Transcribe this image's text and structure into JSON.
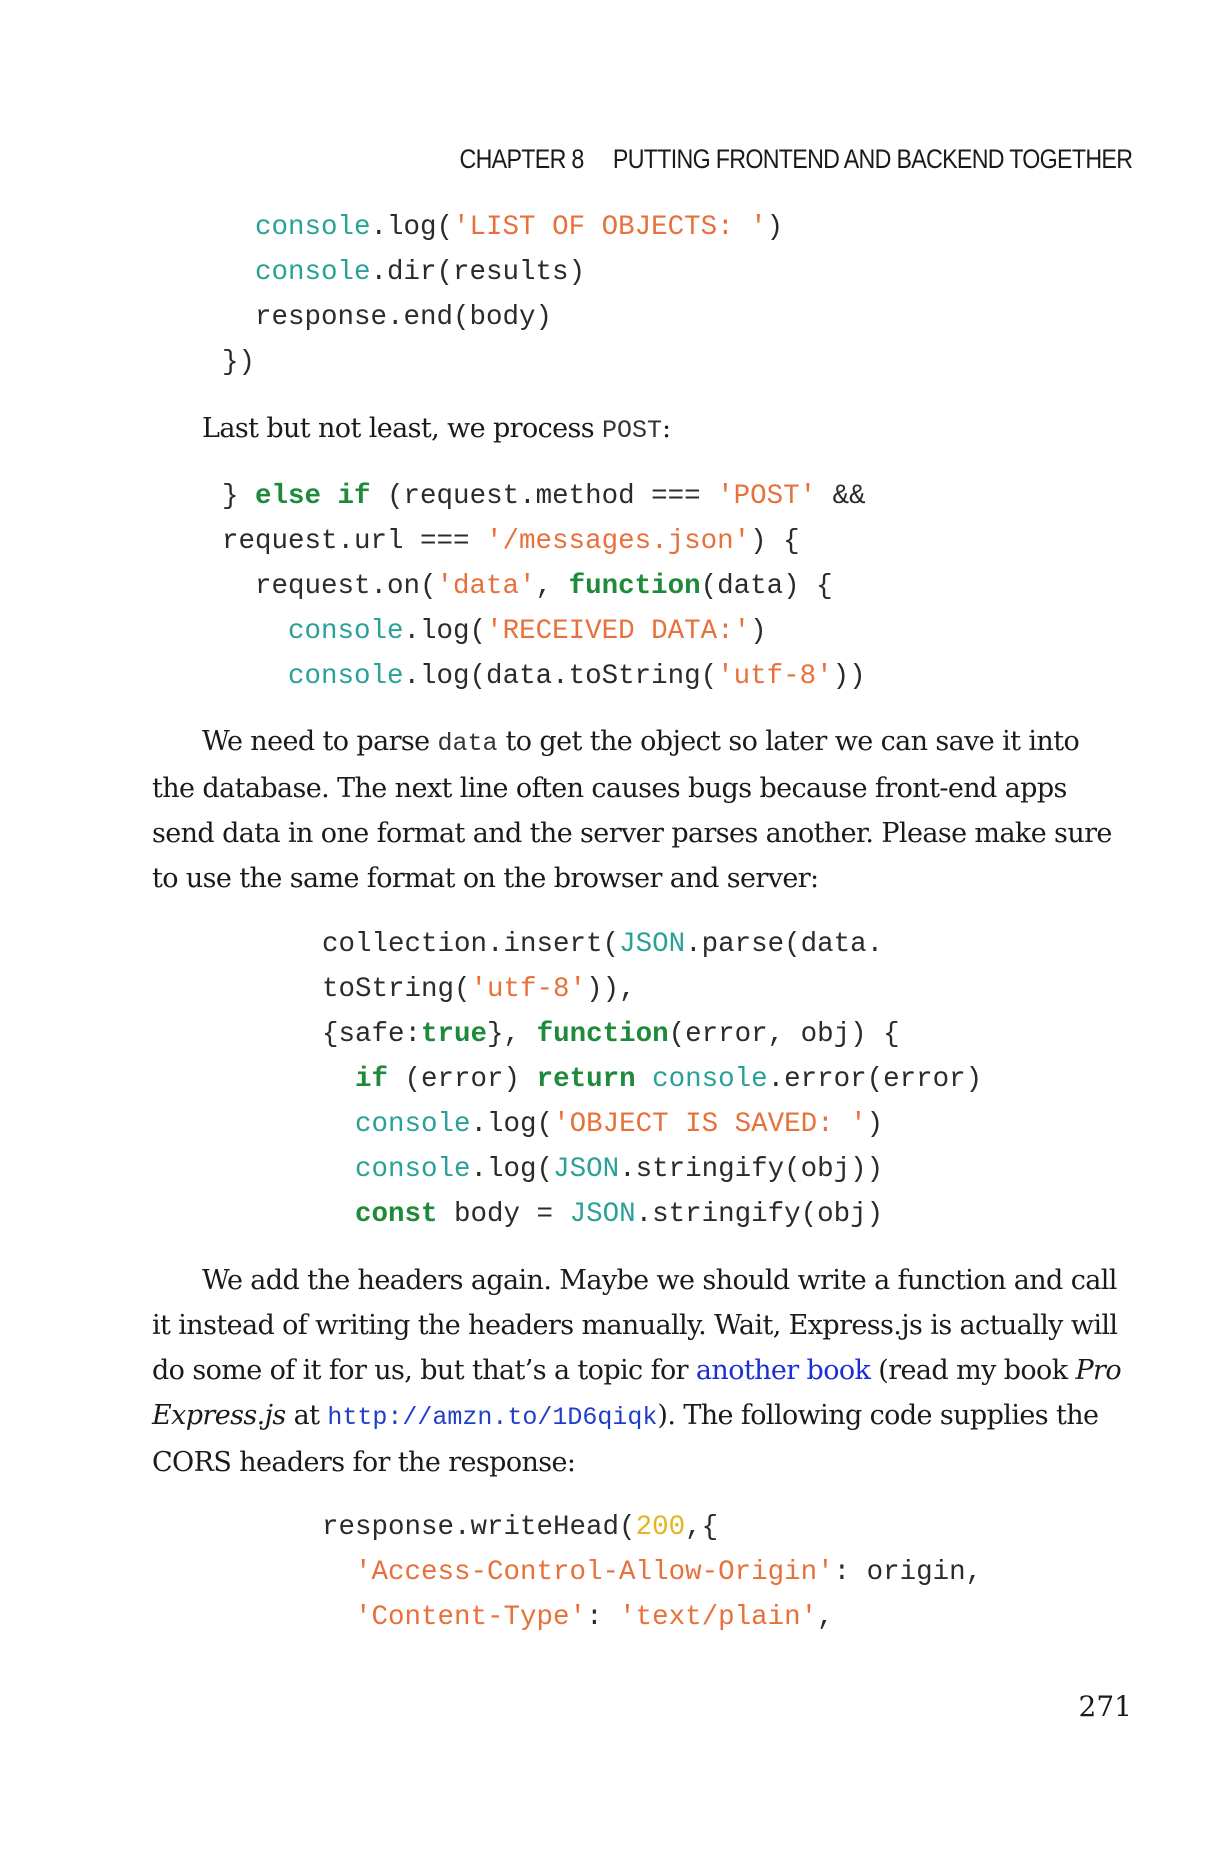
{
  "header": {
    "chapter": "CHAPTER 8",
    "title": "PUTTING FRONTEND AND BACKEND TOGETHER"
  },
  "code1": {
    "l1_obj": "console",
    "l1_a": ".log(",
    "l1_str": "'LIST OF OBJECTS: '",
    "l1_b": ")",
    "l2_obj": "console",
    "l2_a": ".dir(results)",
    "l3": "response.end(body)",
    "l4": "})"
  },
  "para1": {
    "text_a": "Last but not least, we process ",
    "code": "POST",
    "text_b": ":"
  },
  "code2": {
    "l1_a": "} ",
    "l1_kw": "else if",
    "l1_b": " (request.method === ",
    "l1_str": "'POST'",
    "l1_c": " &&",
    "l2_a": "request.url === ",
    "l2_str": "'/messages.json'",
    "l2_b": ") {",
    "l3_a": "request.on(",
    "l3_str": "'data'",
    "l3_b": ", ",
    "l3_kw": "function",
    "l3_c": "(data) {",
    "l4_obj": "console",
    "l4_a": ".log(",
    "l4_str": "'RECEIVED DATA:'",
    "l4_b": ")",
    "l5_obj": "console",
    "l5_a": ".log(data.toString(",
    "l5_str": "'utf-8'",
    "l5_b": "))"
  },
  "para2": {
    "text_a": "We need to parse ",
    "code": "data",
    "text_b": " to get the object so later we can save it into the database. The next line often causes bugs because front-end apps send data in one format and the server parses another. Please make sure to use the same format on the browser and server:"
  },
  "code3": {
    "l1_a": "collection.insert(",
    "l1_obj": "JSON",
    "l1_b": ".parse(data.",
    "l2_a": "toString(",
    "l2_str": "'utf-8'",
    "l2_b": ")),",
    "l3_a": "{safe:",
    "l3_kw1": "true",
    "l3_b": "}, ",
    "l3_kw2": "function",
    "l3_c": "(error, obj) {",
    "l4_kw1": "if",
    "l4_a": " (error) ",
    "l4_kw2": "return",
    "l4_b": " ",
    "l4_obj": "console",
    "l4_c": ".error(error)",
    "l5_obj": "console",
    "l5_a": ".log(",
    "l5_str": "'OBJECT IS SAVED: '",
    "l5_b": ")",
    "l6_obj1": "console",
    "l6_a": ".log(",
    "l6_obj2": "JSON",
    "l6_b": ".stringify(obj))",
    "l7_kw": "const",
    "l7_a": " body = ",
    "l7_obj": "JSON",
    "l7_b": ".stringify(obj)"
  },
  "para3": {
    "text_a": "We add the headers again. Maybe we should write a function and call it instead of writing the headers manually. Wait, Express.js is actually will do some of it for us, but that’s a topic for ",
    "link": "another book",
    "text_b": " (read my book ",
    "em": "Pro Express.js",
    "text_c": " at ",
    "url": "http://amzn.to/1D6qiqk",
    "text_d": "). The following code supplies the CORS headers for the response:"
  },
  "code4": {
    "l1_a": "response.writeHead(",
    "l1_num": "200",
    "l1_b": ",{",
    "l2_str": "'Access-Control-Allow-Origin'",
    "l2_a": ": origin,",
    "l3_str1": "'Content-Type'",
    "l3_a": ": ",
    "l3_str2": "'text/plain'",
    "l3_b": ","
  },
  "page_number": "271",
  "colors": {
    "keyword": "#1e8a3a",
    "string": "#e8703a",
    "object": "#2aa198",
    "number": "#e6b422",
    "link": "#1a2ed6"
  }
}
